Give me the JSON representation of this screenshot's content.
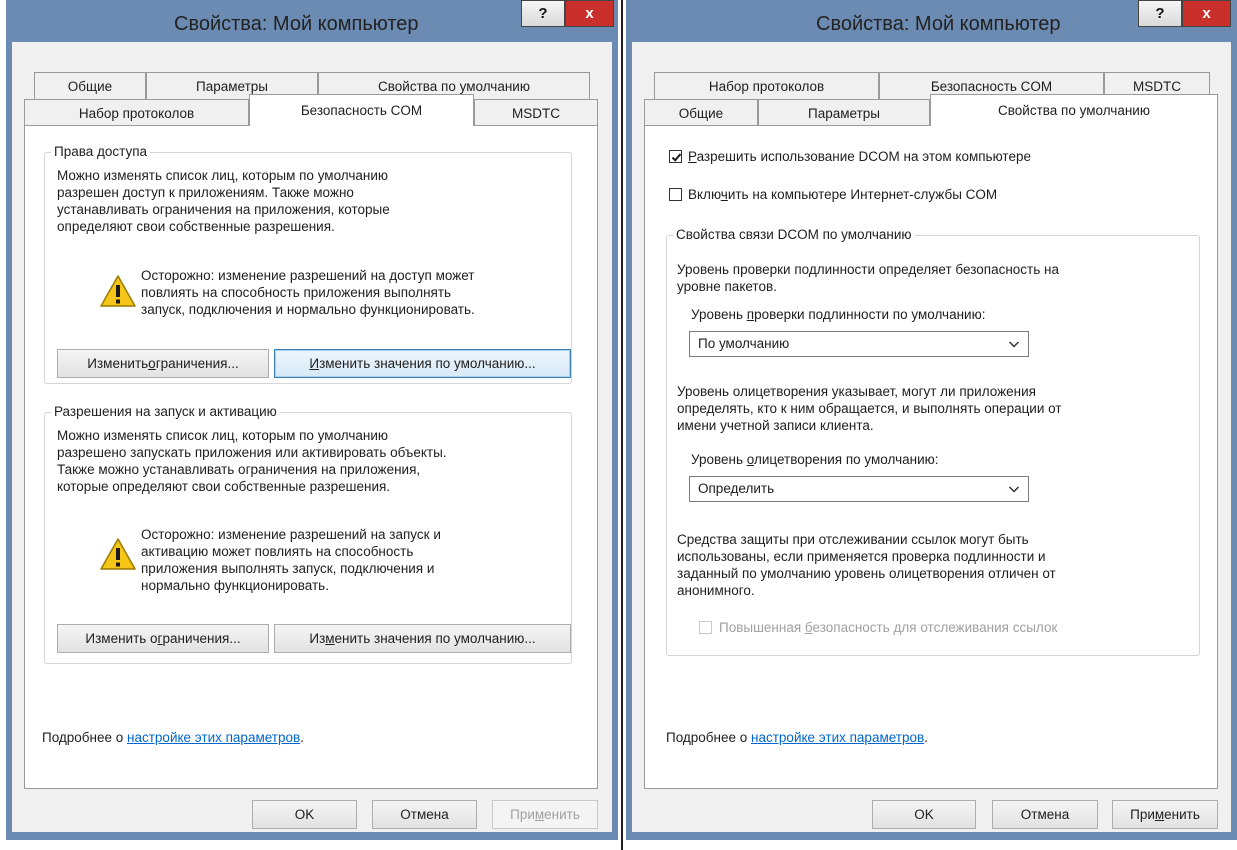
{
  "left": {
    "title": "Свойства: Мой компьютер",
    "help": "?",
    "close": "x",
    "tabs_row1": [
      "Общие",
      "Параметры",
      "Свойства по умолчанию"
    ],
    "tabs_row2": [
      "Набор протоколов",
      "Безопасность COM",
      "MSDTC"
    ],
    "access": {
      "legend": "Права доступа",
      "desc": [
        "Можно изменять список лиц, которым по умолчанию",
        "разрешен доступ к приложениям. Также можно",
        "устанавливать ограничения на приложения, которые",
        "определяют свои собственные разрешения."
      ],
      "warning": [
        "Осторожно: изменение разрешений на доступ может",
        "повлиять на способность приложения выполнять",
        "запуск, подключения и нормально функционировать."
      ],
      "edit_limits": {
        "pre": "Изменить ",
        "hot": "о",
        "post": "граничения..."
      },
      "edit_default": {
        "pre": "",
        "hot": "И",
        "post": "зменить значения по умолчанию..."
      }
    },
    "launch": {
      "legend": "Разрешения на запуск и активацию",
      "desc": [
        "Можно изменять список лиц, которым по умолчанию",
        "разрешено запускать приложения или активировать объекты.",
        "Также можно устанавливать ограничения на приложения,",
        "которые определяют свои собственные разрешения."
      ],
      "warning": [
        "Осторожно: изменение разрешений на запуск и",
        "активацию может повлиять на способность",
        "приложения выполнять запуск, подключения и",
        "нормально функционировать."
      ],
      "edit_limits": {
        "pre": "Изменить о",
        "hot": "г",
        "post": "раничения..."
      },
      "edit_default": {
        "pre": "Из",
        "hot": "м",
        "post": "енить значения по умолчанию..."
      }
    },
    "more_prefix": "Подробнее о ",
    "more_link": "настройке этих параметров",
    "more_suffix": ".",
    "ok": "OK",
    "cancel": "Отмена",
    "apply": {
      "pre": "При",
      "hot": "м",
      "post": "енить"
    }
  },
  "right": {
    "title": "Свойства: Мой компьютер",
    "help": "?",
    "close": "x",
    "tabs_row1": [
      "Набор протоколов",
      "Безопасность COM",
      "MSDTC"
    ],
    "tabs_row2": [
      "Общие",
      "Параметры",
      "Свойства по умолчанию"
    ],
    "enable_dcom": {
      "pre": "",
      "hot": "Р",
      "post": "азрешить использование DCOM на этом компьютере",
      "checked": true
    },
    "enable_internet": {
      "pre": "Вклю",
      "hot": "ч",
      "post": "ить на компьютере Интернет-службы COM",
      "checked": false
    },
    "group_legend": "Свойства связи DCOM по умолчанию",
    "auth_desc": [
      "Уровень проверки подлинности определяет безопасность на",
      "уровне пакетов."
    ],
    "auth_label": {
      "pre": "Уровень ",
      "hot": "п",
      "post": "роверки подлинности по умолчанию:"
    },
    "auth_value": "По умолчанию",
    "imp_desc": [
      "Уровень олицетворения указывает, могут ли приложения",
      "определять, кто к ним обращается, и выполнять операции от",
      "имени учетной записи клиента."
    ],
    "imp_label": {
      "pre": "Уровень ",
      "hot": "о",
      "post": "лицетворения по умолчанию:"
    },
    "imp_value": "Определить",
    "ref_desc": [
      "Средства защиты при отслеживании ссылок могут быть",
      "использованы, если применяется проверка подлинности и",
      "заданный по умолчанию уровень олицетворения отличен от",
      "анонимного."
    ],
    "ref_check": {
      "pre": "Повышенная ",
      "hot": "б",
      "post": "езопасность для отслеживания ссылок",
      "checked": false
    },
    "more_prefix": "Подробнее о ",
    "more_link": "настройке этих параметров",
    "more_suffix": ".",
    "ok": "OK",
    "cancel": "Отмена",
    "apply": {
      "pre": "При",
      "hot": "м",
      "post": "енить"
    }
  }
}
